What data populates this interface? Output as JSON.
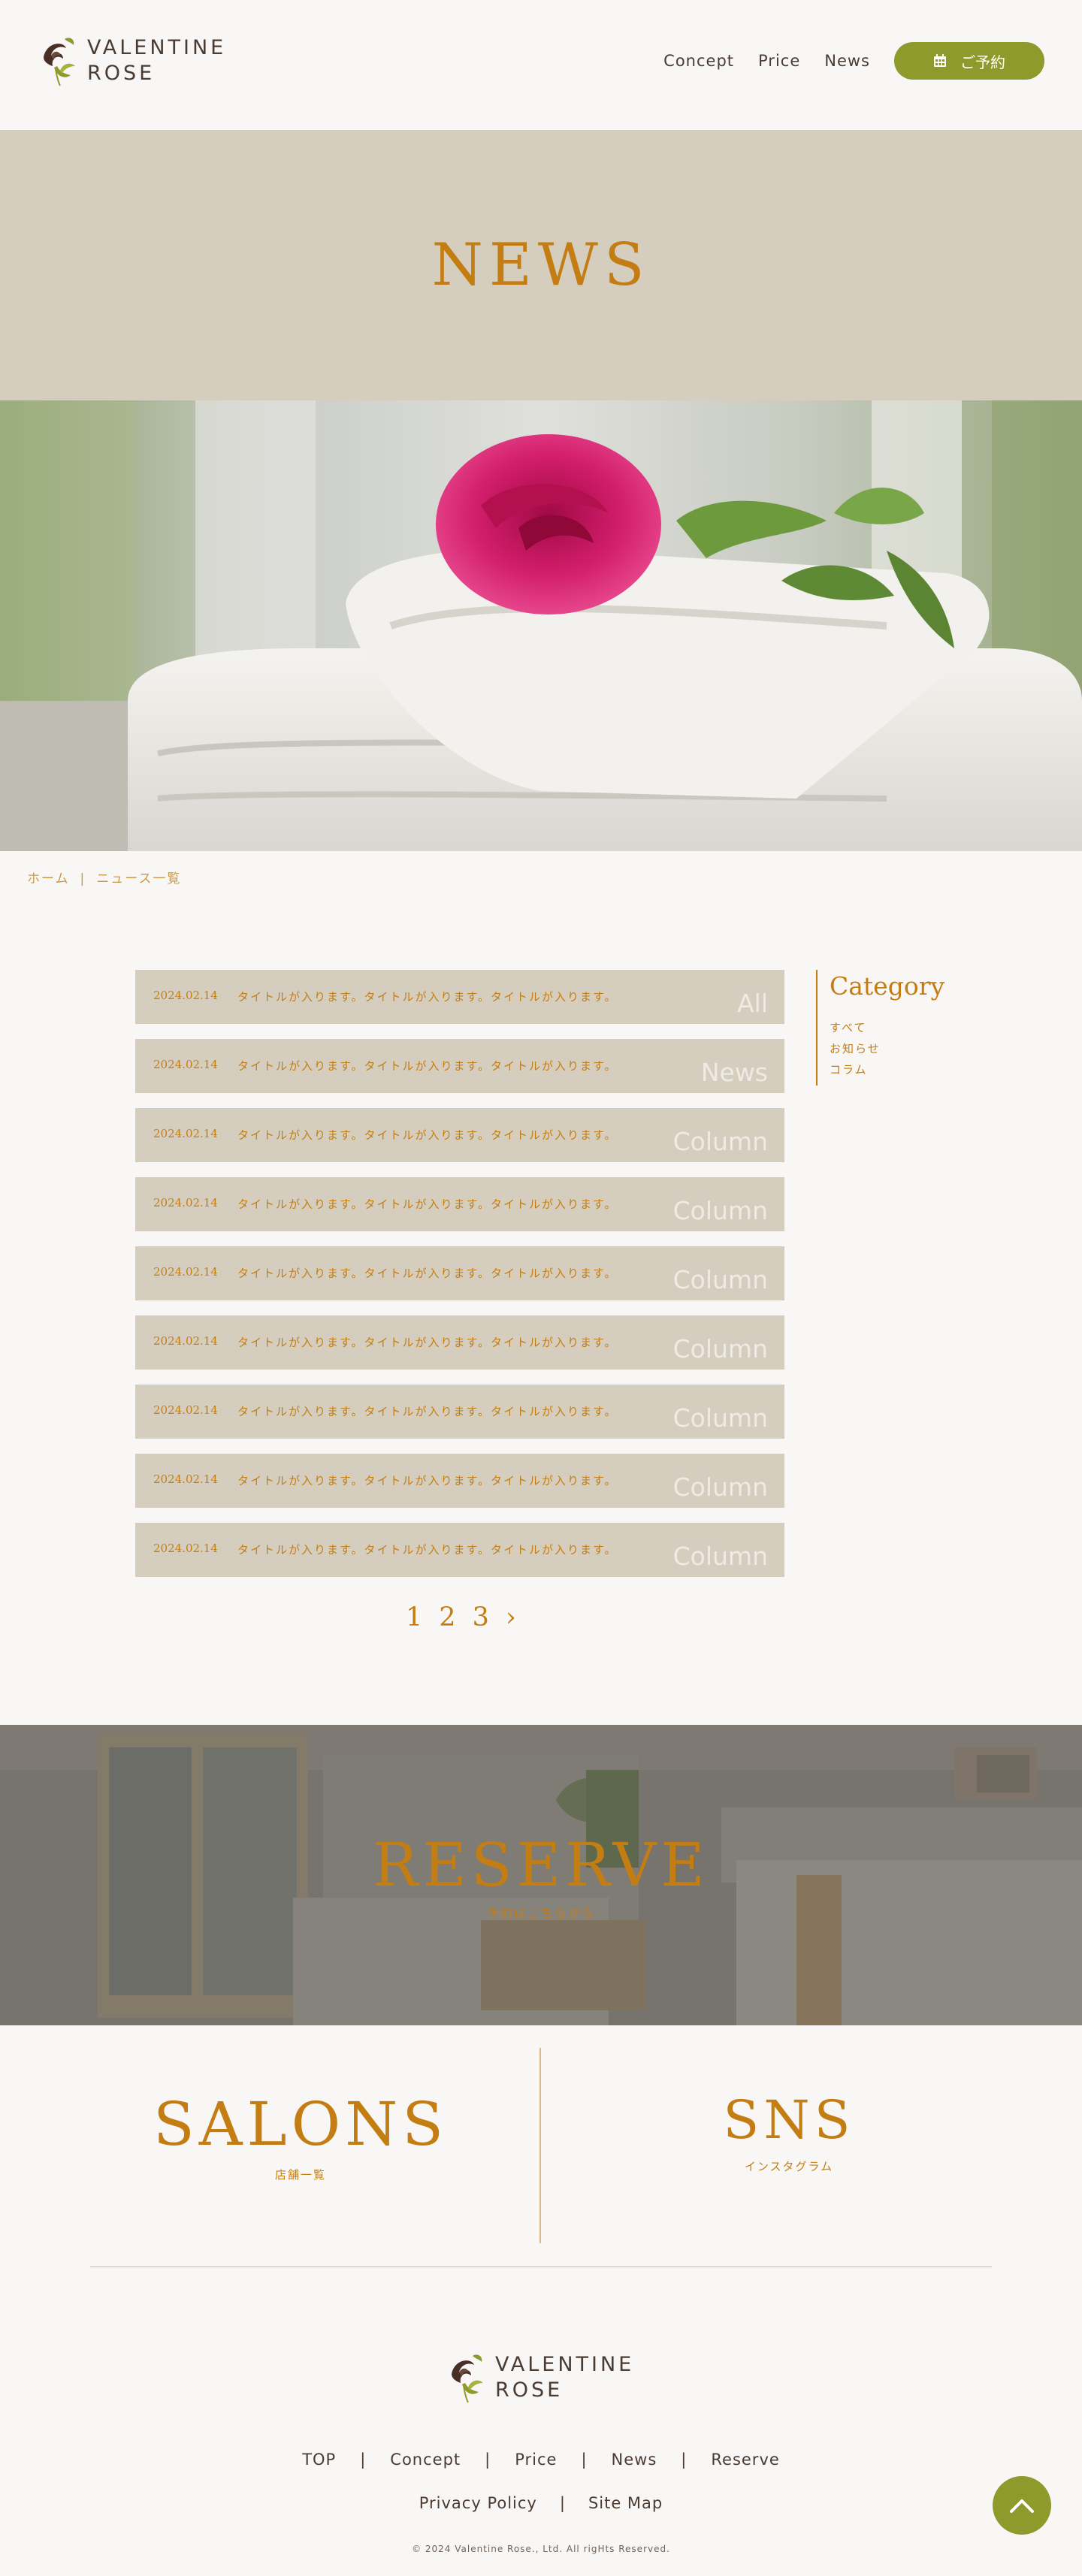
{
  "brand": {
    "line1": "VALENTINE",
    "line2": "ROSE"
  },
  "nav": {
    "concept": "Concept",
    "price": "Price",
    "news": "News",
    "reserve": "ご予約"
  },
  "page_title": "NEWS",
  "breadcrumb": {
    "home": "ホーム",
    "sep": "|",
    "current": "ニュース一覧"
  },
  "news": [
    {
      "date": "2024.02.14",
      "title": "タイトルが入ります。タイトルが入ります。タイトルが入ります。",
      "category": "All"
    },
    {
      "date": "2024.02.14",
      "title": "タイトルが入ります。タイトルが入ります。タイトルが入ります。",
      "category": "News"
    },
    {
      "date": "2024.02.14",
      "title": "タイトルが入ります。タイトルが入ります。タイトルが入ります。",
      "category": "Column"
    },
    {
      "date": "2024.02.14",
      "title": "タイトルが入ります。タイトルが入ります。タイトルが入ります。",
      "category": "Column"
    },
    {
      "date": "2024.02.14",
      "title": "タイトルが入ります。タイトルが入ります。タイトルが入ります。",
      "category": "Column"
    },
    {
      "date": "2024.02.14",
      "title": "タイトルが入ります。タイトルが入ります。タイトルが入ります。",
      "category": "Column"
    },
    {
      "date": "2024.02.14",
      "title": "タイトルが入ります。タイトルが入ります。タイトルが入ります。",
      "category": "Column"
    },
    {
      "date": "2024.02.14",
      "title": "タイトルが入ります。タイトルが入ります。タイトルが入ります。",
      "category": "Column"
    },
    {
      "date": "2024.02.14",
      "title": "タイトルが入ります。タイトルが入ります。タイトルが入ります。",
      "category": "Column"
    }
  ],
  "sidebar": {
    "heading": "Category",
    "items": [
      "すべて",
      "お知らせ",
      "コラム"
    ]
  },
  "pagination": {
    "pages": [
      "1",
      "2",
      "3"
    ],
    "next": "›"
  },
  "reserve": {
    "heading": "RESERVE",
    "sub": "予約はこちらから"
  },
  "salons": {
    "heading": "SALONS",
    "sub": "店舗一覧"
  },
  "sns": {
    "heading": "SNS",
    "sub": "インスタグラム"
  },
  "footer": {
    "nav": [
      "TOP",
      "Concept",
      "Price",
      "News",
      "Reserve"
    ],
    "nav2": [
      "Privacy Policy",
      "Site Map"
    ],
    "sep": "|",
    "copyright": "© 2024 Valentine Rose., Ltd. All rigHts Reserved."
  },
  "colors": {
    "accent": "#c47d12",
    "olive": "#8f9a2c",
    "band": "#d5cebf",
    "bg": "#f8f7f5",
    "text": "#4a3b33"
  },
  "icons": [
    "rose-logo-icon",
    "calendar-icon",
    "chevron-right-icon",
    "chevron-up-icon"
  ]
}
